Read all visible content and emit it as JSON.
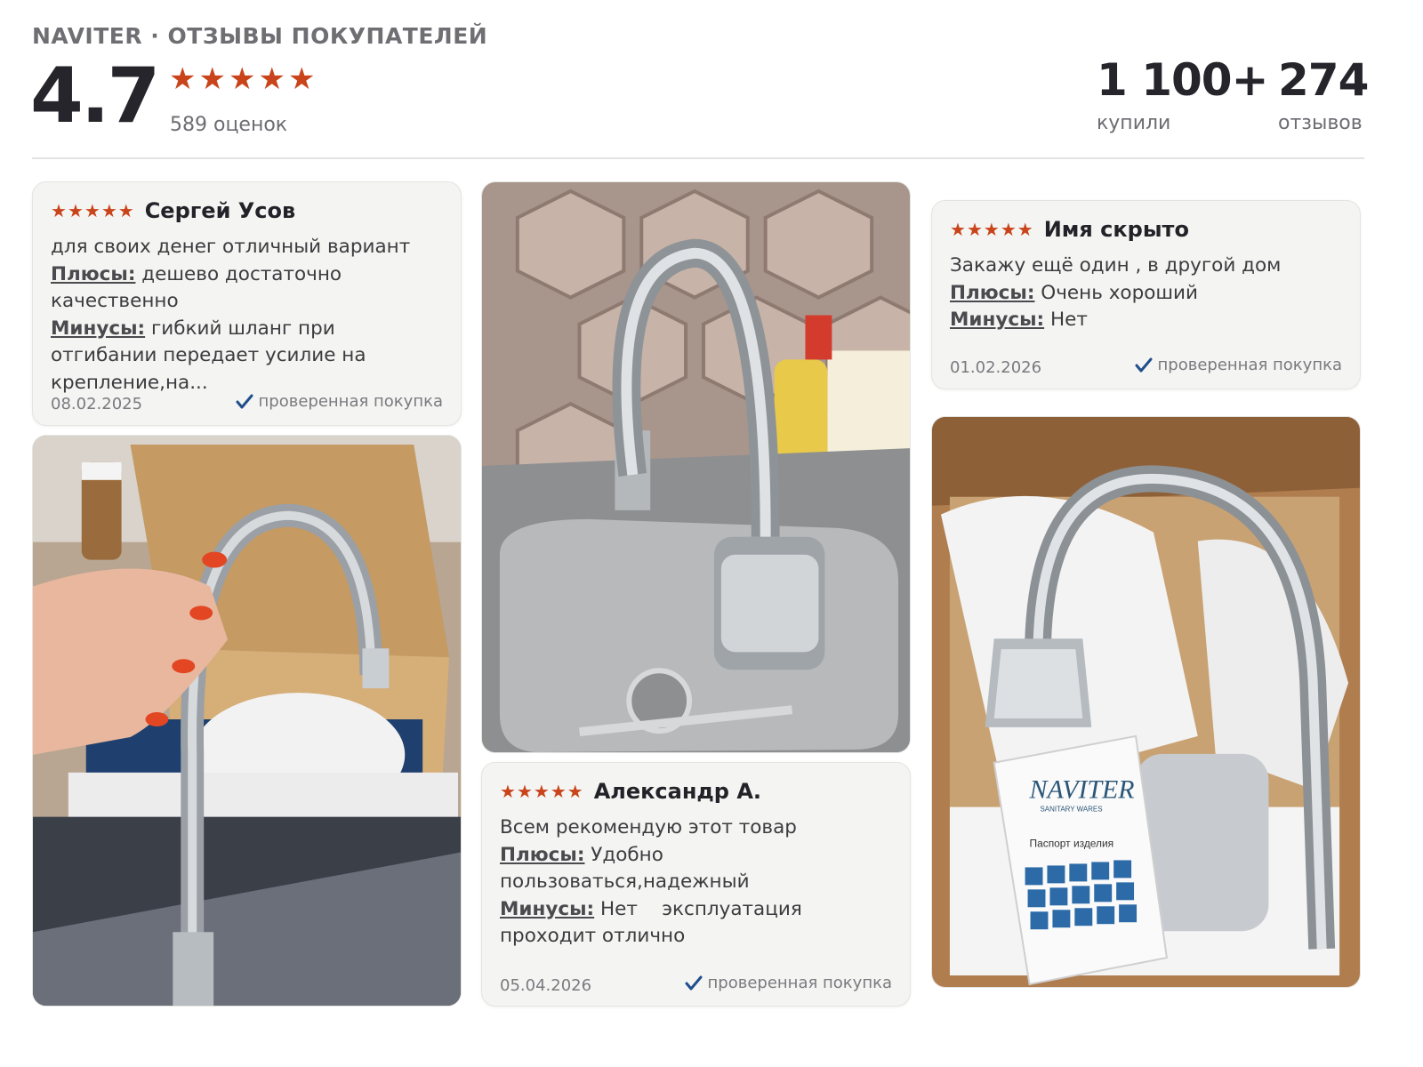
{
  "header": {
    "brand_line": "NAVITER · ОТЗЫВЫ ПОКУПАТЕЛЕЙ",
    "rating": "4.7",
    "stars": [
      "★",
      "★",
      "★",
      "★",
      "★"
    ],
    "ratings_count": "589 оценок",
    "bought_value": "1 100+",
    "bought_label": "купили",
    "reviews_value": "274",
    "reviews_label": "отзывов"
  },
  "colors": {
    "star": "#c9441a",
    "check": "#1f4e8c",
    "card_bg": "#f4f4f2"
  },
  "reviews": [
    {
      "stars": [
        "★",
        "★",
        "★",
        "★",
        "★"
      ],
      "author": "Сергей Усов",
      "text": "для своих денег отличный вариант",
      "pros_label": "Плюсы:",
      "pros": "дешево достаточно качественно",
      "cons_label": "Минусы:",
      "cons": "гибкий шланг при отгибании передает усилие на крепление,на...",
      "date": "08.02.2025",
      "verified": "проверенная покупка"
    },
    {
      "stars": [
        "★",
        "★",
        "★",
        "★",
        "★"
      ],
      "author": "Имя скрыто",
      "text": "Закажу ещё один , в другой дом",
      "pros_label": "Плюсы:",
      "pros": "Очень хороший",
      "cons_label": "Минусы:",
      "cons": "Нет",
      "date": "01.02.2026",
      "verified": "проверенная покупка"
    },
    {
      "stars": [
        "★",
        "★",
        "★",
        "★",
        "★"
      ],
      "author": "Александр А.",
      "text": "Всем рекомендую этот товар",
      "pros_label": "Плюсы:",
      "pros": "Удобно пользоваться,надежный",
      "cons_label": "Минусы:",
      "cons": "Нет    эксплуатация проходит отлично",
      "date": "05.04.2026",
      "verified": "проверенная покупка"
    }
  ],
  "photos": {
    "box_text": "NAVITER",
    "box_subtext": "SANITARY WARES",
    "box_passport": "Паспорт изделия"
  }
}
